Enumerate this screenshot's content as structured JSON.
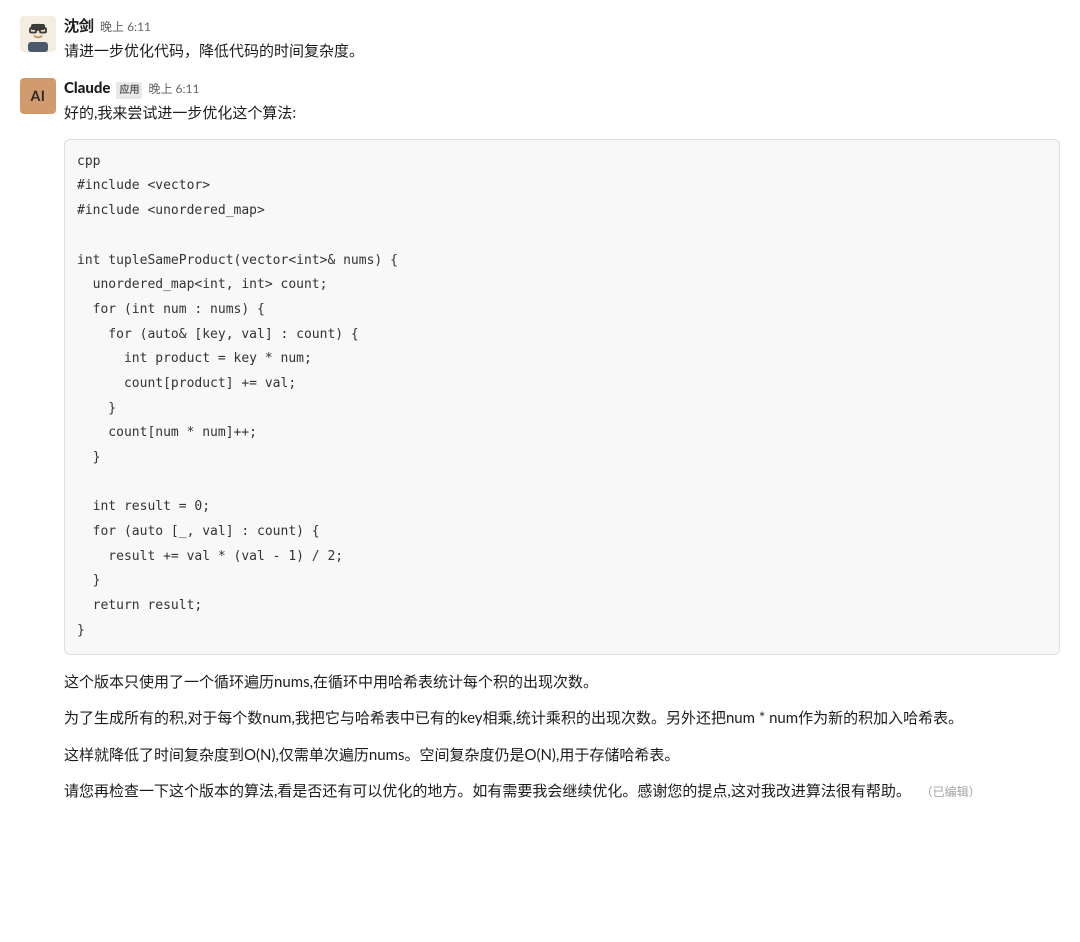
{
  "messages": [
    {
      "sender_name": "沈剑",
      "timestamp": "晚上 6:11",
      "body": "请进一步优化代码，降低代码的时间复杂度。"
    },
    {
      "sender_name": "Claude",
      "app_badge": "应用",
      "timestamp": "晚上 6:11",
      "intro": "好的,我来尝试进一步优化这个算法:",
      "code": "cpp\n#include <vector>\n#include <unordered_map>\n\nint tupleSameProduct(vector<int>& nums) {\n  unordered_map<int, int> count;\n  for (int num : nums) {\n    for (auto& [key, val] : count) {\n      int product = key * num;\n      count[product] += val;\n    }\n    count[num * num]++;\n  }\n\n  int result = 0;\n  for (auto [_, val] : count) {\n    result += val * (val - 1) / 2;\n  }\n  return result;\n}",
      "paragraphs": [
        "这个版本只使用了一个循环遍历nums,在循环中用哈希表统计每个积的出现次数。",
        "为了生成所有的积,对于每个数num,我把它与哈希表中已有的key相乘,统计乘积的出现次数。另外还把num * num作为新的积加入哈希表。",
        "这样就降低了时间复杂度到O(N),仅需单次遍历nums。空间复杂度仍是O(N),用于存储哈希表。"
      ],
      "final_paragraph": "请您再检查一下这个版本的算法,看是否还有可以优化的地方。如有需要我会继续优化。感谢您的提点,这对我改进算法很有帮助。",
      "edited_label": "（已编辑）"
    }
  ],
  "icons": {
    "claude_avatar_text": "AI"
  }
}
